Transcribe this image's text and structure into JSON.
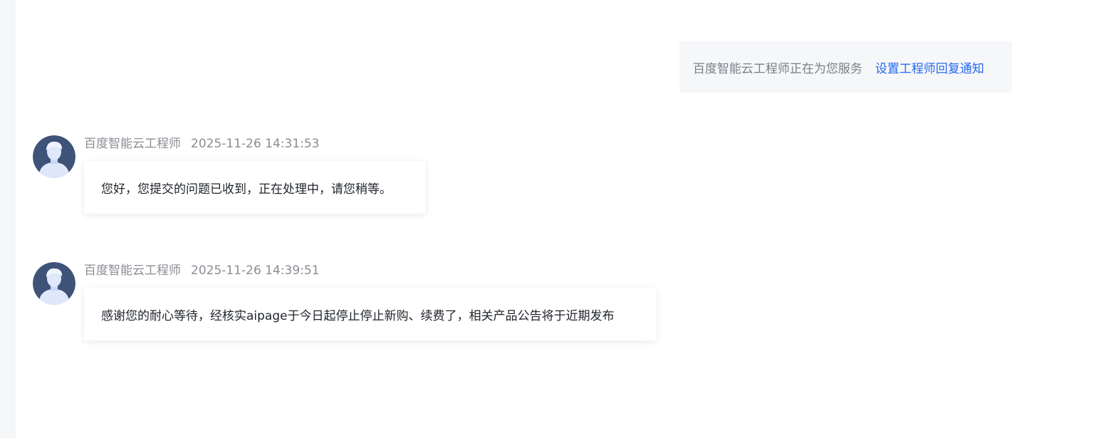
{
  "notice": {
    "text": "百度智能云工程师正在为您服务",
    "link": "设置工程师回复通知"
  },
  "messages": [
    {
      "sender": "百度智能云工程师",
      "time": "2025-11-26 14:31:53",
      "text": "您好，您提交的问题已收到，正在处理中，请您稍等。"
    },
    {
      "sender": "百度智能云工程师",
      "time": "2025-11-26 14:39:51",
      "text": "感谢您的耐心等待，经核实aipage于今日起停止停止新购、续费了，相关产品公告将于近期发布"
    }
  ],
  "colors": {
    "link": "#2468f2",
    "avatar_bg": "#3f5277",
    "avatar_figure": "#dfe8fb"
  }
}
